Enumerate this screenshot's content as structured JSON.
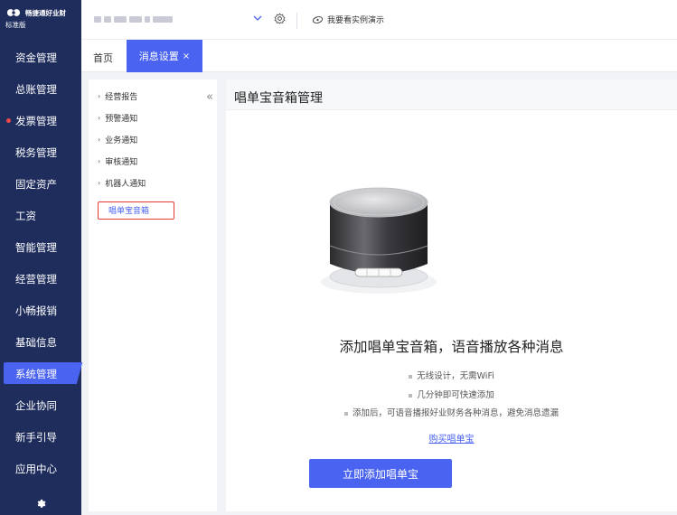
{
  "app": {
    "logo_name": "畅捷通好业财",
    "edition": "标准版"
  },
  "sidebar": {
    "items": [
      {
        "label": "资金管理"
      },
      {
        "label": "总账管理"
      },
      {
        "label": "发票管理"
      },
      {
        "label": "税务管理"
      },
      {
        "label": "固定资产"
      },
      {
        "label": "工资"
      },
      {
        "label": "智能管理"
      },
      {
        "label": "经营管理"
      },
      {
        "label": "小畅报销"
      },
      {
        "label": "基础信息"
      },
      {
        "label": "系统管理"
      },
      {
        "label": "企业协同"
      },
      {
        "label": "新手引导"
      },
      {
        "label": "应用中心"
      }
    ],
    "active_index": 10,
    "dot_index": 2
  },
  "topbar": {
    "demo_label": "我要看实例演示"
  },
  "tabs": {
    "home": "首页",
    "active": "消息设置",
    "close": "×"
  },
  "tree": {
    "items": [
      {
        "label": "经营报告"
      },
      {
        "label": "预警通知"
      },
      {
        "label": "业务通知"
      },
      {
        "label": "审核通知"
      },
      {
        "label": "机器人通知"
      }
    ],
    "selected": "唱单宝音箱",
    "collapse_icon": "«"
  },
  "main": {
    "title": "唱单宝音箱管理",
    "headline": "添加唱单宝音箱，语音播放各种消息",
    "bullets": [
      "无线设计，无需WiFi",
      "几分钟即可快速添加",
      "添加后，可语音播报好业财务各种消息，避免消息遗漏"
    ],
    "buy_link": "购买唱单宝",
    "add_button": "立即添加唱单宝"
  },
  "colors": {
    "sidebar_bg": "#1f2d5c",
    "accent": "#4a63f0",
    "highlight_border": "#e53935"
  }
}
